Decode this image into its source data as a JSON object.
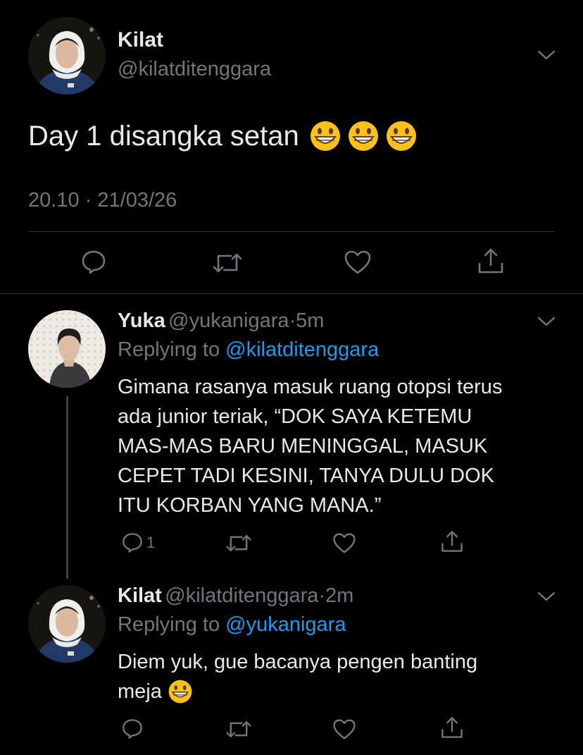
{
  "main_tweet": {
    "name": "Kilat",
    "handle": "@kilatditenggara",
    "text": "Day 1 disangka setan",
    "emoji_icons": [
      "grinning-face-icon",
      "grinning-face-icon",
      "grinning-face-icon"
    ],
    "time": "20.10",
    "separator": "·",
    "date": "21/03/26",
    "actions": [
      "reply-icon",
      "retweet-icon",
      "like-icon",
      "share-icon"
    ]
  },
  "replies": [
    {
      "name": "Yuka",
      "handle": "@yukanigara",
      "separator": "·",
      "age": "5m",
      "replying_label": "Replying to",
      "replying_to": "@kilatditenggara",
      "body_lines": [
        "Gimana rasanya masuk ruang otopsi terus",
        "ada junior teriak, “DOK SAYA KETEMU",
        "MAS-MAS BARU MENINGGAL, MASUK",
        "CEPET TADI KESINI, TANYA DULU DOK",
        "ITU KORBAN YANG MANA.”"
      ],
      "reply_count": "1"
    },
    {
      "name": "Kilat",
      "handle": "@kilatditenggara",
      "separator": "·",
      "age": "2m",
      "replying_label": "Replying to",
      "replying_to": "@yukanigara",
      "body_lines": [
        "Diem yuk, gue bacanya pengen banting",
        "meja"
      ],
      "emoji_icons": [
        "grinning-face-icon"
      ]
    }
  ],
  "colors": {
    "background": "#000000",
    "text": "#e7e9ea",
    "secondary": "#71767b",
    "link": "#1d9bf0",
    "divider": "#2f3336"
  }
}
